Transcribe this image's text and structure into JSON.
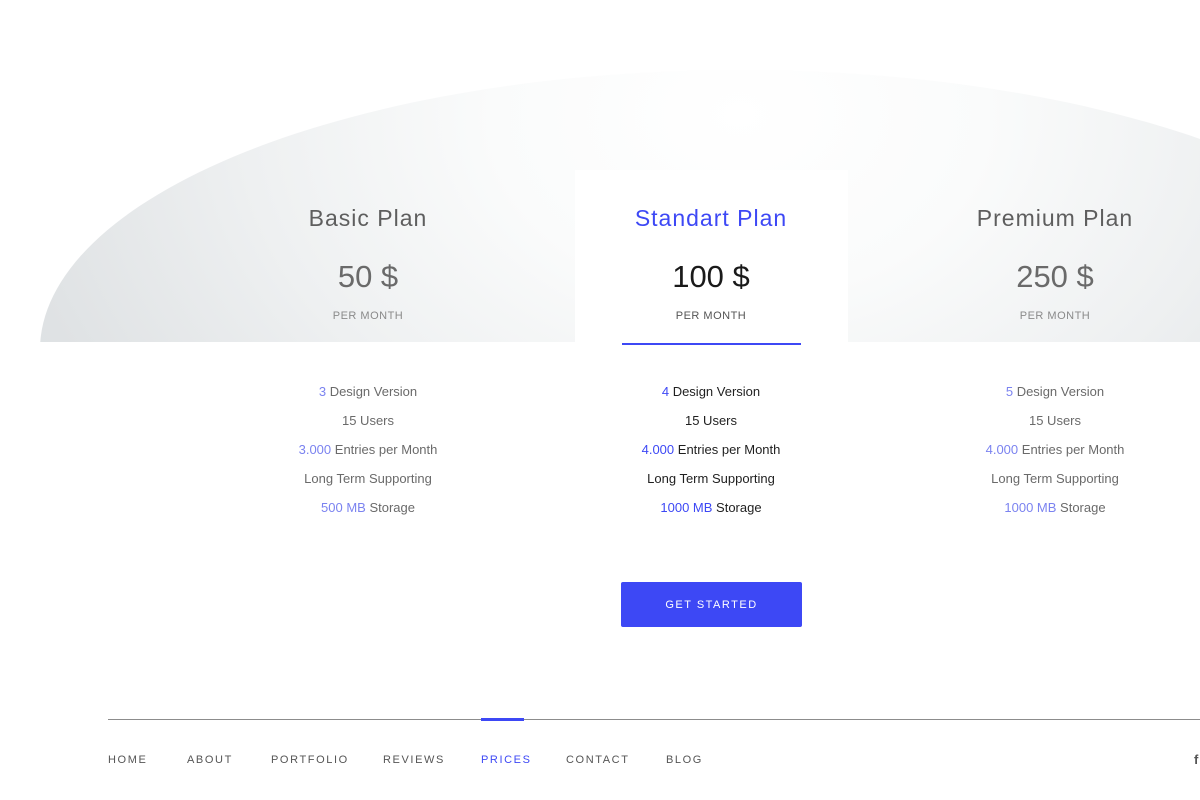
{
  "colors": {
    "accent": "#3d48f5",
    "text": "#5e5e5e",
    "muted": "#8a8a8a",
    "background_arc": "#dfe2e4"
  },
  "plans": [
    {
      "name": "Basic Plan",
      "price": "50 $",
      "period": "PER MONTH",
      "featured": false,
      "features": [
        {
          "highlight": "3",
          "text": " Design Version"
        },
        {
          "highlight": "",
          "text": "15 Users"
        },
        {
          "highlight": "3.000",
          "text": " Entries per Month"
        },
        {
          "highlight": "",
          "text": "Long Term Supporting"
        },
        {
          "highlight": "500 MB",
          "text": " Storage"
        }
      ]
    },
    {
      "name": "Standart Plan",
      "price": "100 $",
      "period": "PER MONTH",
      "featured": true,
      "features": [
        {
          "highlight": "4",
          "text": " Design Version"
        },
        {
          "highlight": "",
          "text": "15 Users"
        },
        {
          "highlight": "4.000",
          "text": " Entries per Month"
        },
        {
          "highlight": "",
          "text": "Long Term Supporting"
        },
        {
          "highlight": "1000 MB",
          "text": " Storage"
        }
      ]
    },
    {
      "name": "Premium Plan",
      "price": "250 $",
      "period": "PER MONTH",
      "featured": false,
      "features": [
        {
          "highlight": "5",
          "text": " Design Version"
        },
        {
          "highlight": "",
          "text": "15 Users"
        },
        {
          "highlight": "4.000",
          "text": " Entries per Month"
        },
        {
          "highlight": "",
          "text": "Long Term Supporting"
        },
        {
          "highlight": "1000 MB",
          "text": " Storage"
        }
      ]
    }
  ],
  "cta": {
    "label": "GET STARTED"
  },
  "footer": {
    "nav": [
      "HOME",
      "ABOUT",
      "PORTFOLIO",
      "REVIEWS",
      "PRICES",
      "CONTACT",
      "BLOG"
    ],
    "active": "PRICES",
    "social_icon": "facebook-icon",
    "social_glyph": "f"
  }
}
